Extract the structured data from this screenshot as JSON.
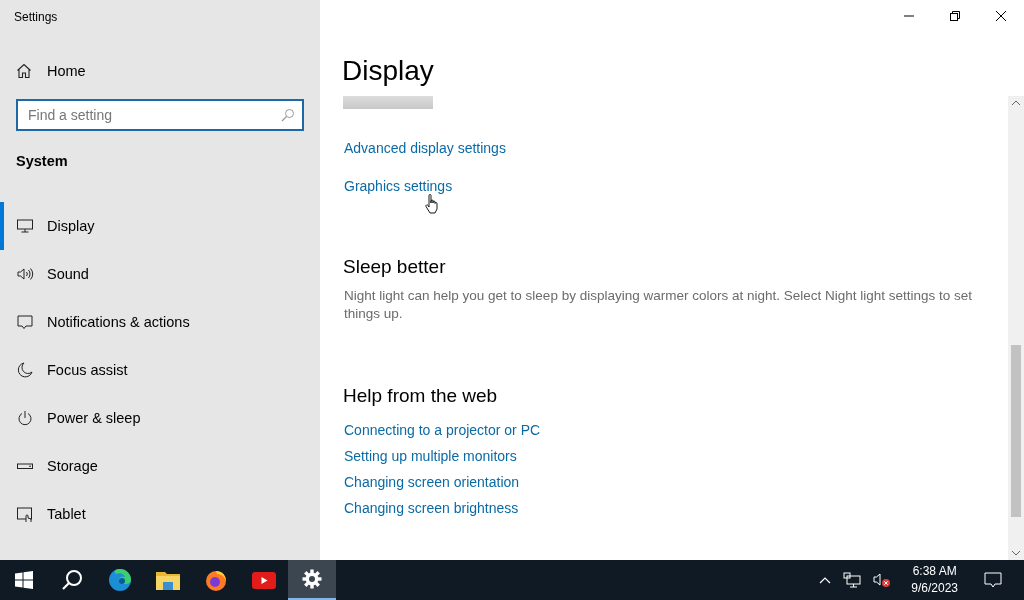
{
  "window": {
    "title": "Settings"
  },
  "sidebar": {
    "home": "Home",
    "search": {
      "placeholder": "Find a setting"
    },
    "section": "System",
    "items": [
      {
        "label": "Display",
        "selected": true
      },
      {
        "label": "Sound",
        "selected": false
      },
      {
        "label": "Notifications & actions",
        "selected": false
      },
      {
        "label": "Focus assist",
        "selected": false
      },
      {
        "label": "Power & sleep",
        "selected": false
      },
      {
        "label": "Storage",
        "selected": false
      },
      {
        "label": "Tablet",
        "selected": false
      }
    ]
  },
  "content": {
    "title": "Display",
    "links": [
      "Advanced display settings",
      "Graphics settings"
    ],
    "sections": [
      {
        "heading": "Sleep better",
        "text": "Night light can help you get to sleep by displaying warmer colors at night. Select Night light settings to set things up."
      },
      {
        "heading": "Help from the web",
        "links": [
          "Connecting to a projector or PC",
          "Setting up multiple monitors",
          "Changing screen orientation",
          "Changing screen brightness"
        ]
      }
    ]
  },
  "taskbar": {
    "apps": [
      {
        "selected": false
      },
      {
        "selected": false
      },
      {
        "selected": false
      },
      {
        "selected": false
      },
      {
        "selected": true
      }
    ],
    "time": "6:38 AM",
    "date": "9/6/2023"
  }
}
